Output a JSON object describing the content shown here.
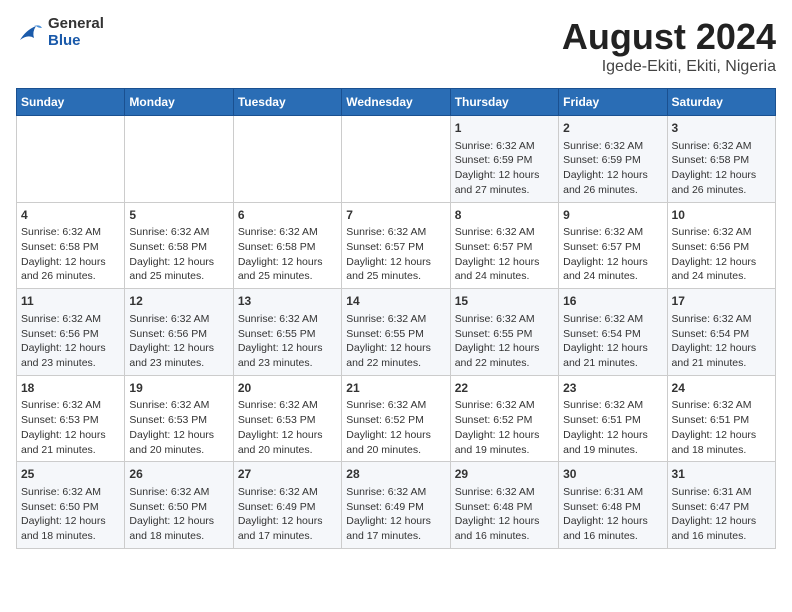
{
  "header": {
    "logo": {
      "line1": "General",
      "line2": "Blue"
    },
    "title": "August 2024",
    "subtitle": "Igede-Ekiti, Ekiti, Nigeria"
  },
  "weekdays": [
    "Sunday",
    "Monday",
    "Tuesday",
    "Wednesday",
    "Thursday",
    "Friday",
    "Saturday"
  ],
  "weeks": [
    [
      {
        "day": "",
        "info": ""
      },
      {
        "day": "",
        "info": ""
      },
      {
        "day": "",
        "info": ""
      },
      {
        "day": "",
        "info": ""
      },
      {
        "day": "1",
        "info": "Sunrise: 6:32 AM\nSunset: 6:59 PM\nDaylight: 12 hours\nand 27 minutes."
      },
      {
        "day": "2",
        "info": "Sunrise: 6:32 AM\nSunset: 6:59 PM\nDaylight: 12 hours\nand 26 minutes."
      },
      {
        "day": "3",
        "info": "Sunrise: 6:32 AM\nSunset: 6:58 PM\nDaylight: 12 hours\nand 26 minutes."
      }
    ],
    [
      {
        "day": "4",
        "info": "Sunrise: 6:32 AM\nSunset: 6:58 PM\nDaylight: 12 hours\nand 26 minutes."
      },
      {
        "day": "5",
        "info": "Sunrise: 6:32 AM\nSunset: 6:58 PM\nDaylight: 12 hours\nand 25 minutes."
      },
      {
        "day": "6",
        "info": "Sunrise: 6:32 AM\nSunset: 6:58 PM\nDaylight: 12 hours\nand 25 minutes."
      },
      {
        "day": "7",
        "info": "Sunrise: 6:32 AM\nSunset: 6:57 PM\nDaylight: 12 hours\nand 25 minutes."
      },
      {
        "day": "8",
        "info": "Sunrise: 6:32 AM\nSunset: 6:57 PM\nDaylight: 12 hours\nand 24 minutes."
      },
      {
        "day": "9",
        "info": "Sunrise: 6:32 AM\nSunset: 6:57 PM\nDaylight: 12 hours\nand 24 minutes."
      },
      {
        "day": "10",
        "info": "Sunrise: 6:32 AM\nSunset: 6:56 PM\nDaylight: 12 hours\nand 24 minutes."
      }
    ],
    [
      {
        "day": "11",
        "info": "Sunrise: 6:32 AM\nSunset: 6:56 PM\nDaylight: 12 hours\nand 23 minutes."
      },
      {
        "day": "12",
        "info": "Sunrise: 6:32 AM\nSunset: 6:56 PM\nDaylight: 12 hours\nand 23 minutes."
      },
      {
        "day": "13",
        "info": "Sunrise: 6:32 AM\nSunset: 6:55 PM\nDaylight: 12 hours\nand 23 minutes."
      },
      {
        "day": "14",
        "info": "Sunrise: 6:32 AM\nSunset: 6:55 PM\nDaylight: 12 hours\nand 22 minutes."
      },
      {
        "day": "15",
        "info": "Sunrise: 6:32 AM\nSunset: 6:55 PM\nDaylight: 12 hours\nand 22 minutes."
      },
      {
        "day": "16",
        "info": "Sunrise: 6:32 AM\nSunset: 6:54 PM\nDaylight: 12 hours\nand 21 minutes."
      },
      {
        "day": "17",
        "info": "Sunrise: 6:32 AM\nSunset: 6:54 PM\nDaylight: 12 hours\nand 21 minutes."
      }
    ],
    [
      {
        "day": "18",
        "info": "Sunrise: 6:32 AM\nSunset: 6:53 PM\nDaylight: 12 hours\nand 21 minutes."
      },
      {
        "day": "19",
        "info": "Sunrise: 6:32 AM\nSunset: 6:53 PM\nDaylight: 12 hours\nand 20 minutes."
      },
      {
        "day": "20",
        "info": "Sunrise: 6:32 AM\nSunset: 6:53 PM\nDaylight: 12 hours\nand 20 minutes."
      },
      {
        "day": "21",
        "info": "Sunrise: 6:32 AM\nSunset: 6:52 PM\nDaylight: 12 hours\nand 20 minutes."
      },
      {
        "day": "22",
        "info": "Sunrise: 6:32 AM\nSunset: 6:52 PM\nDaylight: 12 hours\nand 19 minutes."
      },
      {
        "day": "23",
        "info": "Sunrise: 6:32 AM\nSunset: 6:51 PM\nDaylight: 12 hours\nand 19 minutes."
      },
      {
        "day": "24",
        "info": "Sunrise: 6:32 AM\nSunset: 6:51 PM\nDaylight: 12 hours\nand 18 minutes."
      }
    ],
    [
      {
        "day": "25",
        "info": "Sunrise: 6:32 AM\nSunset: 6:50 PM\nDaylight: 12 hours\nand 18 minutes."
      },
      {
        "day": "26",
        "info": "Sunrise: 6:32 AM\nSunset: 6:50 PM\nDaylight: 12 hours\nand 18 minutes."
      },
      {
        "day": "27",
        "info": "Sunrise: 6:32 AM\nSunset: 6:49 PM\nDaylight: 12 hours\nand 17 minutes."
      },
      {
        "day": "28",
        "info": "Sunrise: 6:32 AM\nSunset: 6:49 PM\nDaylight: 12 hours\nand 17 minutes."
      },
      {
        "day": "29",
        "info": "Sunrise: 6:32 AM\nSunset: 6:48 PM\nDaylight: 12 hours\nand 16 minutes."
      },
      {
        "day": "30",
        "info": "Sunrise: 6:31 AM\nSunset: 6:48 PM\nDaylight: 12 hours\nand 16 minutes."
      },
      {
        "day": "31",
        "info": "Sunrise: 6:31 AM\nSunset: 6:47 PM\nDaylight: 12 hours\nand 16 minutes."
      }
    ]
  ]
}
